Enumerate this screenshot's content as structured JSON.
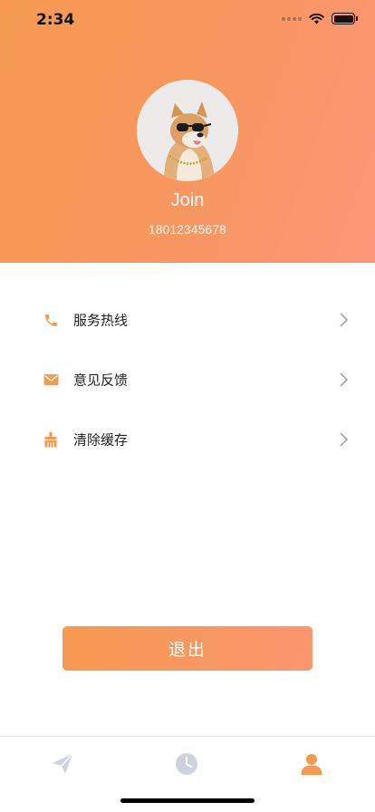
{
  "status_bar": {
    "time": "2:34"
  },
  "profile": {
    "name": "Join",
    "phone": "18012345678"
  },
  "menu": {
    "items": [
      {
        "label": "服务热线",
        "icon": "phone-icon"
      },
      {
        "label": "意见反馈",
        "icon": "mail-icon"
      },
      {
        "label": "清除缓存",
        "icon": "broom-icon"
      }
    ]
  },
  "logout": {
    "label": "退出"
  },
  "tabbar": {
    "tabs": [
      {
        "icon": "paper-plane-icon",
        "active": false
      },
      {
        "icon": "clock-icon",
        "active": false
      },
      {
        "icon": "person-icon",
        "active": true
      }
    ]
  },
  "colors": {
    "accent": "#f59a50",
    "accent_end": "#fd9677",
    "inactive_tab": "#cfd3dc"
  }
}
